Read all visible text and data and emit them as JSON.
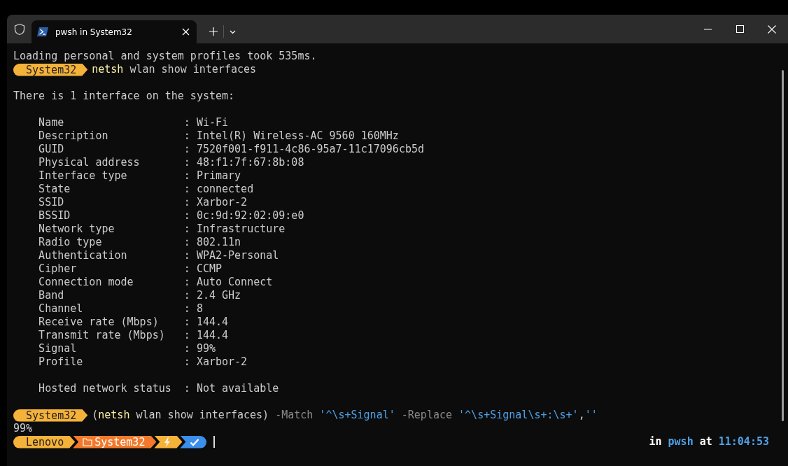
{
  "window": {
    "tab_title": "pwsh in System32"
  },
  "lines": [
    {
      "kind": "text",
      "text": "Loading personal and system profiles took 535ms."
    },
    {
      "kind": "prompt",
      "segment": "System32",
      "tokens": [
        {
          "kind": "command",
          "text": "netsh"
        },
        {
          "kind": "plain",
          "text": " wlan show interfaces"
        }
      ]
    },
    {
      "kind": "blank"
    },
    {
      "kind": "text",
      "text": "There is 1 interface on the system:"
    },
    {
      "kind": "blank"
    },
    {
      "kind": "text",
      "text": "    Name                   : Wi-Fi"
    },
    {
      "kind": "text",
      "text": "    Description            : Intel(R) Wireless-AC 9560 160MHz"
    },
    {
      "kind": "text",
      "text": "    GUID                   : 7520f001-f911-4c86-95a7-11c17096cb5d"
    },
    {
      "kind": "text",
      "text": "    Physical address       : 48:f1:7f:67:8b:08"
    },
    {
      "kind": "text",
      "text": "    Interface type         : Primary"
    },
    {
      "kind": "text",
      "text": "    State                  : connected"
    },
    {
      "kind": "text",
      "text": "    SSID                   : Xarbor-2"
    },
    {
      "kind": "text",
      "text": "    BSSID                  : 0c:9d:92:02:09:e0"
    },
    {
      "kind": "text",
      "text": "    Network type           : Infrastructure"
    },
    {
      "kind": "text",
      "text": "    Radio type             : 802.11n"
    },
    {
      "kind": "text",
      "text": "    Authentication         : WPA2-Personal"
    },
    {
      "kind": "text",
      "text": "    Cipher                 : CCMP"
    },
    {
      "kind": "text",
      "text": "    Connection mode        : Auto Connect"
    },
    {
      "kind": "text",
      "text": "    Band                   : 2.4 GHz"
    },
    {
      "kind": "text",
      "text": "    Channel                : 8"
    },
    {
      "kind": "text",
      "text": "    Receive rate (Mbps)    : 144.4"
    },
    {
      "kind": "text",
      "text": "    Transmit rate (Mbps)   : 144.4"
    },
    {
      "kind": "text",
      "text": "    Signal                 : 99%"
    },
    {
      "kind": "text",
      "text": "    Profile                : Xarbor-2"
    },
    {
      "kind": "blank"
    },
    {
      "kind": "text",
      "text": "    Hosted network status  : Not available"
    },
    {
      "kind": "blank"
    },
    {
      "kind": "prompt",
      "segment": "System32",
      "tokens": [
        {
          "kind": "plain",
          "text": "("
        },
        {
          "kind": "command",
          "text": "netsh"
        },
        {
          "kind": "plain",
          "text": " wlan show interfaces) "
        },
        {
          "kind": "param",
          "text": "-Match"
        },
        {
          "kind": "string",
          "text": " '^\\s+Signal'"
        },
        {
          "kind": "param",
          "text": " -Replace"
        },
        {
          "kind": "string",
          "text": " '^\\s+Signal\\s+:\\s+'"
        },
        {
          "kind": "plain",
          "text": ","
        },
        {
          "kind": "string",
          "text": "''"
        }
      ]
    },
    {
      "kind": "text",
      "text": "99%"
    }
  ],
  "final_prompt": {
    "segments": [
      {
        "kind": "host",
        "text": "Lenovo"
      },
      {
        "kind": "path",
        "text": "System32"
      },
      {
        "kind": "power"
      },
      {
        "kind": "status"
      }
    ],
    "right": [
      {
        "kind": "plain",
        "text": "in"
      },
      {
        "kind": "accent",
        "text": "pwsh"
      },
      {
        "kind": "plain",
        "text": "at"
      },
      {
        "kind": "accent",
        "text": "11:04:53"
      }
    ]
  }
}
